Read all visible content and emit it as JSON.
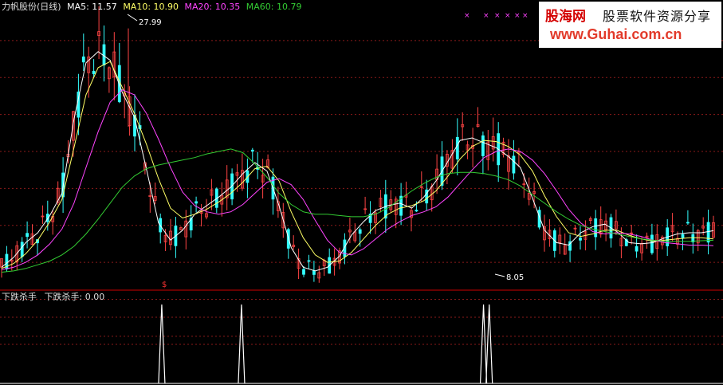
{
  "header": {
    "stock_name": "力帆股份(日线)",
    "ma5_label": "MA5: 11.57",
    "ma10_label": "MA10: 10.90",
    "ma20_label": "MA20: 10.35",
    "ma60_label": "MA60: 10.79"
  },
  "indicator": {
    "name_label": "下跌杀手",
    "value_label": "下跌杀手: 0.00"
  },
  "watermark": {
    "brand": "股海网",
    "slogan": "股票软件资源分享",
    "url": "www.Guhai.com.cn"
  },
  "annotations": {
    "high_label": "27.99",
    "low_label": "8.05",
    "marker_glyph": "$",
    "x_marks": [
      "×",
      "×",
      "×",
      "×",
      "×",
      "×"
    ]
  },
  "colors": {
    "ma5": "#ffffff",
    "ma10": "#ffff66",
    "ma20": "#ff44ff",
    "ma60": "#33cc33",
    "up": "#ff4444",
    "down": "#33ffff",
    "divider": "#cc0000",
    "grid": "#8b1a1a",
    "signal": "#ffffff"
  },
  "chart_data": [
    {
      "type": "line",
      "subtype": "candlestick-with-moving-averages",
      "title": "力帆股份(日线)",
      "y_range": [
        7.0,
        29.0
      ],
      "x_count": 140,
      "series": [
        {
          "name": "MA5",
          "values": [
            8.6,
            9.4,
            10.6,
            11.4,
            12.8,
            14.6,
            20.6,
            25.2,
            26.1,
            25.4,
            22.8,
            20.8,
            16.6,
            12.2,
            10.8,
            11.6,
            12.9,
            13.6,
            14.3,
            15.1,
            16.2,
            17.1,
            16.4,
            13.6,
            10.2,
            8.6,
            8.3,
            8.6,
            9.5,
            11.2,
            12.3,
            13.2,
            13.6,
            13.8,
            13.4,
            14.3,
            15.6,
            17.2,
            18.9,
            19.1,
            18.7,
            18.3,
            17.6,
            16.7,
            14.2,
            11.6,
            10.6,
            10.4,
            11.4,
            11.9,
            12.1,
            11.5,
            10.6,
            10.5,
            10.6,
            11.0,
            11.3,
            11.4,
            11.4,
            11.57
          ]
        },
        {
          "name": "MA10",
          "values": [
            8.5,
            8.9,
            9.7,
            10.8,
            12.3,
            14.1,
            18.3,
            22.6,
            24.8,
            25.3,
            23.2,
            21.1,
            18.6,
            15.8,
            13.4,
            12.6,
            12.9,
            13.3,
            13.9,
            14.6,
            15.5,
            16.6,
            16.8,
            15.6,
            13.1,
            11.0,
            9.6,
            9.0,
            9.1,
            9.8,
            10.9,
            12.0,
            12.9,
            13.4,
            13.6,
            14.0,
            14.8,
            16.0,
            17.4,
            18.4,
            18.9,
            18.8,
            18.4,
            17.7,
            16.4,
            14.4,
            12.7,
            11.4,
            11.1,
            11.3,
            11.6,
            11.6,
            11.2,
            10.9,
            10.7,
            10.8,
            10.9,
            11.0,
            11.0,
            10.9
          ]
        },
        {
          "name": "MA20",
          "values": [
            8.4,
            8.6,
            9.0,
            9.6,
            10.5,
            11.7,
            13.8,
            16.7,
            19.6,
            22.0,
            23.0,
            22.6,
            21.1,
            19.0,
            16.7,
            14.7,
            13.6,
            13.1,
            12.9,
            13.1,
            13.7,
            14.6,
            15.5,
            15.8,
            15.3,
            14.1,
            12.4,
            10.8,
            9.8,
            9.6,
            10.1,
            10.9,
            11.7,
            12.3,
            12.8,
            13.1,
            13.5,
            14.3,
            15.4,
            16.5,
            17.5,
            18.0,
            18.2,
            18.0,
            17.3,
            16.2,
            14.8,
            13.3,
            12.2,
            11.5,
            11.3,
            11.4,
            11.3,
            11.1,
            10.8,
            10.6,
            10.5,
            10.4,
            10.4,
            10.35
          ]
        },
        {
          "name": "MA60",
          "values": [
            8.2,
            8.3,
            8.5,
            8.8,
            9.1,
            9.6,
            10.3,
            11.3,
            12.5,
            13.8,
            15.1,
            16.0,
            16.6,
            16.9,
            17.1,
            17.3,
            17.5,
            17.8,
            18.0,
            18.2,
            17.9,
            17.0,
            15.9,
            14.6,
            13.7,
            13.1,
            12.9,
            12.9,
            12.8,
            12.7,
            12.7,
            12.9,
            13.4,
            14.1,
            14.8,
            15.4,
            15.9,
            16.2,
            16.3,
            16.3,
            16.2,
            16.0,
            15.7,
            15.2,
            14.5,
            13.8,
            13.1,
            12.5,
            12.0,
            11.7,
            11.5,
            11.3,
            11.1,
            10.9,
            10.8,
            10.7,
            10.7,
            10.7,
            10.75,
            10.79
          ]
        }
      ],
      "annotations": {
        "max_price": 27.99,
        "min_price": 8.05
      }
    },
    {
      "type": "line",
      "subtype": "signal-spikes",
      "title": "下跌杀手",
      "current_value": 0.0,
      "y_range": [
        0,
        1
      ],
      "spike_positions": [
        0.225,
        0.337,
        0.677,
        0.685
      ],
      "spike_value": 1
    }
  ]
}
